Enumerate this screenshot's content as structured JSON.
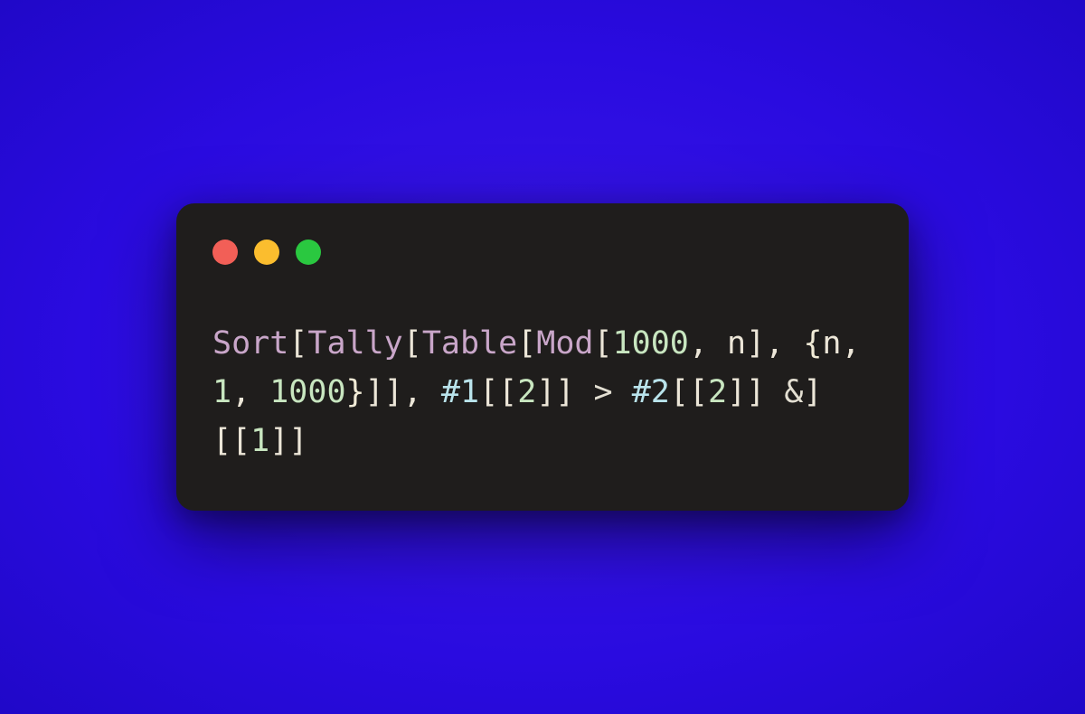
{
  "window": {
    "traffic_lights": {
      "red": "#f25f57",
      "yellow": "#fbbd2e",
      "green": "#2ac840"
    }
  },
  "code": {
    "tokens": {
      "sort": "Sort",
      "tally": "Tally",
      "table": "Table",
      "mod": "Mod",
      "lbr": "[",
      "rbr": "]",
      "lbrace": "{",
      "rbrace": "}",
      "n": "n",
      "num1000": "1000",
      "num1": "1",
      "num2": "2",
      "comma_sp": ", ",
      "sp": " ",
      "slot1": "#1",
      "slot2": "#2",
      "gt": ">",
      "amp": "&"
    }
  }
}
